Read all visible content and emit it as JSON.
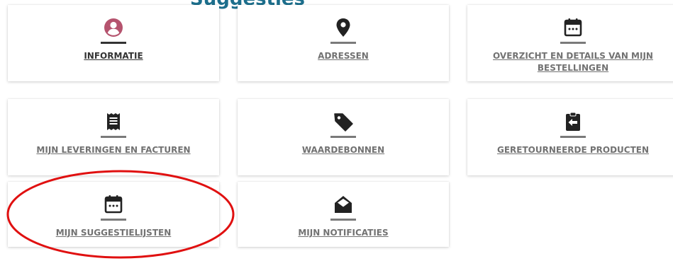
{
  "tiles": [
    {
      "label": "INFORMATIE",
      "icon": "user-icon"
    },
    {
      "label": "ADRESSEN",
      "icon": "map-pin-icon"
    },
    {
      "label": "OVERZICHT EN DETAILS VAN MIJN BESTELLINGEN",
      "icon": "calendar-icon"
    },
    {
      "label": "MIJN LEVERINGEN EN FACTUREN",
      "icon": "receipt-icon"
    },
    {
      "label": "WAARDEBONNEN",
      "icon": "tag-icon"
    },
    {
      "label": "GERETOURNEERDE PRODUCTEN",
      "icon": "return-clipboard-icon"
    },
    {
      "label": "MIJN SUGGESTIELIJSTEN",
      "icon": "calendar-icon"
    },
    {
      "label": "MIJN NOTIFICATIES",
      "icon": "envelope-open-icon"
    }
  ],
  "colors": {
    "accent_active_icon": "#b5536e",
    "icon_default": "#222222",
    "label_default": "#727272",
    "label_active": "#333333",
    "highlight_annotation": "#e01010"
  }
}
